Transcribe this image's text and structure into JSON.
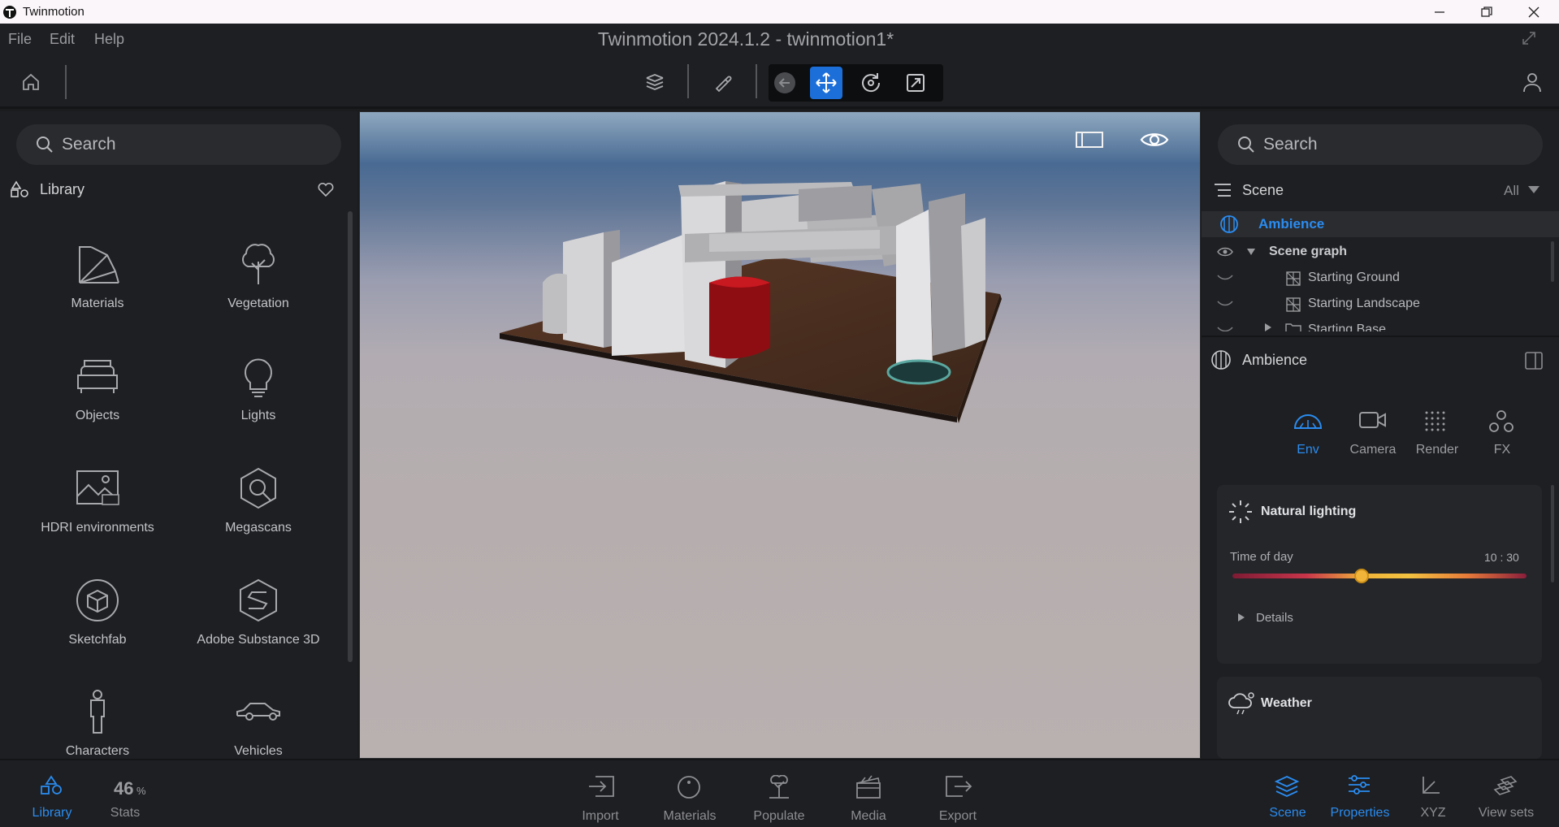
{
  "window": {
    "app_name": "Twinmotion",
    "controls": [
      "minimize-icon",
      "restore-icon",
      "close-icon"
    ]
  },
  "menu": {
    "items": [
      "File",
      "Edit",
      "Help"
    ],
    "document_title": "Twinmotion 2024.1.2 - twinmotion1*"
  },
  "toolbar": {
    "tools": [
      "home-icon",
      "layers-icon",
      "eyedropper-icon",
      "back-icon",
      "move-icon",
      "rotate-icon",
      "scale-icon",
      "user-icon"
    ],
    "active_tool": "move-icon"
  },
  "library": {
    "search_placeholder": "Search",
    "title": "Library",
    "items": [
      {
        "label": "Materials",
        "icon": "materials-icon"
      },
      {
        "label": "Vegetation",
        "icon": "vegetation-icon"
      },
      {
        "label": "Objects",
        "icon": "objects-icon"
      },
      {
        "label": "Lights",
        "icon": "lights-icon"
      },
      {
        "label": "HDRI environments",
        "icon": "hdri-icon"
      },
      {
        "label": "Megascans",
        "icon": "megascans-icon"
      },
      {
        "label": "Sketchfab",
        "icon": "sketchfab-icon"
      },
      {
        "label": "Adobe Substance 3D",
        "icon": "substance-icon"
      },
      {
        "label": "Characters",
        "icon": "characters-icon"
      },
      {
        "label": "Vehicles",
        "icon": "vehicles-icon"
      }
    ]
  },
  "scene": {
    "search_placeholder": "Search",
    "title": "Scene",
    "filter": "All",
    "tree": [
      {
        "label": "Ambience",
        "selected": true
      },
      {
        "label": "Scene graph"
      },
      {
        "label": "Starting Ground"
      },
      {
        "label": "Starting Landscape"
      },
      {
        "label": "Starting Base"
      }
    ]
  },
  "properties": {
    "title": "Ambience",
    "tabs": [
      {
        "label": "Env",
        "active": true
      },
      {
        "label": "Camera"
      },
      {
        "label": "Render"
      },
      {
        "label": "FX"
      }
    ],
    "natural_lighting": {
      "title": "Natural lighting",
      "time_label": "Time of day",
      "time_value": "10 : 30",
      "slider_fraction": 0.44,
      "details_label": "Details"
    },
    "weather": {
      "title": "Weather"
    }
  },
  "bottom_bar": {
    "left": [
      {
        "label": "Library",
        "active": true
      },
      {
        "label": "Stats",
        "value": "46",
        "unit": "%"
      }
    ],
    "center": [
      "Import",
      "Materials",
      "Populate",
      "Media",
      "Export"
    ],
    "right": [
      {
        "label": "Scene",
        "active": true
      },
      {
        "label": "Properties",
        "active": true
      },
      {
        "label": "XYZ"
      },
      {
        "label": "View sets"
      }
    ]
  },
  "colors": {
    "accent": "#2a8cf0",
    "panel": "#1e1f22",
    "slider_knob": "#f0b43a"
  }
}
